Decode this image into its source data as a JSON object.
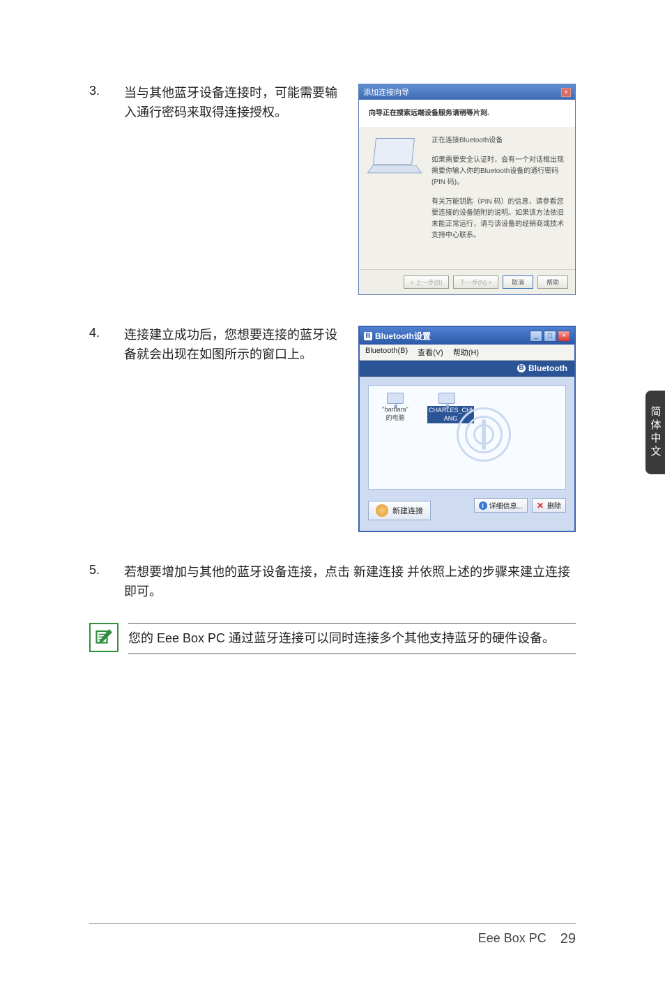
{
  "steps": {
    "s3": {
      "num": "3.",
      "text": "当与其他蓝牙设备连接时，可能需要输入通行密码来取得连接授权。"
    },
    "s4": {
      "num": "4.",
      "text": "连接建立成功后，您想要连接的蓝牙设备就会出现在如图所示的窗口上。"
    },
    "s5": {
      "num": "5.",
      "text": "若想要增加与其他的蓝牙设备连接，点击 新建连接 并依照上述的步骤来建立连接即可。"
    }
  },
  "wizard": {
    "title": "添加连接向导",
    "subtitle": "向导正在搜索远端设备服务请稍等片刻.",
    "line1": "正在连接Bluetooth设备",
    "line2": "如果需要安全认证时，会有一个对话框出现需要你输入你的Bluetooth设备的通行密码(PIN 码)。",
    "line3": "有关万能钥匙（PIN 码）的信息，请参看您要连接的设备随附的说明。如果该方法依旧未能正常运行，请与该设备的经销商或技术支持中心联系。",
    "btn_back": "< 上一步(B)",
    "btn_next": "下一步(N) >",
    "btn_cancel": "取消",
    "btn_help": "帮助"
  },
  "btwindow": {
    "title": "Bluetooth设置",
    "menu_bt": "Bluetooth(B)",
    "menu_view": "查看(V)",
    "menu_help": "帮助(H)",
    "brand": "Bluetooth",
    "dev1_a": "\"barbara\"",
    "dev1_b": "的电脑",
    "dev2_a": "CHARLES_CHI",
    "dev2_b": "ANG",
    "btn_new": "新建连接",
    "btn_detail": "详细信息...",
    "btn_delete": "删除"
  },
  "note": {
    "text": "您的 Eee Box PC 通过蓝牙连接可以同时连接多个其他支持蓝牙的硬件设备。"
  },
  "side_tab": "简体中文",
  "footer": {
    "product": "Eee Box PC",
    "page": "29"
  }
}
